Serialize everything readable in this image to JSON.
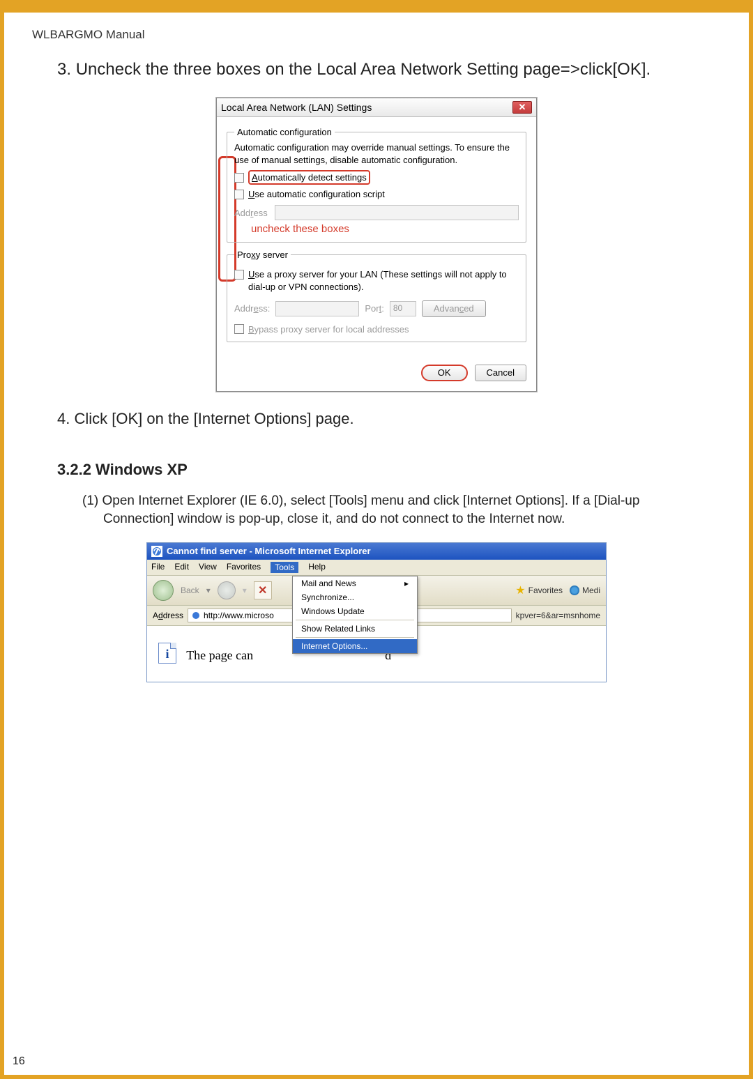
{
  "header": "WLBARGMO Manual",
  "step3_num": "3. ",
  "step3_text": "Uncheck the three boxes on the Local Area Network Setting page=>click[OK].",
  "lan": {
    "title": "Local Area Network (LAN) Settings",
    "group1_legend": "Automatic configuration",
    "group1_para": "Automatic configuration may override manual settings.  To ensure the use of manual settings, disable automatic configuration.",
    "auto_detect": "Automatically detect settings",
    "use_script": "Use automatic configuration script",
    "address_lbl": "Address",
    "uncheck_hint": "uncheck these boxes",
    "group2_legend": "Proxy server",
    "use_proxy": "Use a proxy server for your LAN (These settings will not apply to dial-up or VPN connections).",
    "port_lbl": "Port:",
    "port_val": "80",
    "advanced": "Advanced",
    "bypass": "Bypass proxy server for local addresses",
    "ok": "OK",
    "cancel": "Cancel"
  },
  "step4_num": "4. ",
  "step4_text": "Click [OK] on the [Internet Options] page.",
  "sec_heading": "3.2.2 Windows XP",
  "body1_num": "(1) ",
  "body1_text": "Open Internet Explorer (IE 6.0), select [Tools] menu and click [Internet Options]. If a [Dial-up Connection] window is pop-up, close it, and do not connect to the Internet now.",
  "ie": {
    "title": "Cannot find server - Microsoft Internet Explorer",
    "menu": {
      "file": "File",
      "edit": "Edit",
      "view": "View",
      "favorites_m": "Favorites",
      "tools": "Tools",
      "help": "Help"
    },
    "back": "Back",
    "favorites": "Favorites",
    "media": "Medi",
    "addr_label": "Address",
    "addr_val": "http://www.microso",
    "addr_frag": "kpver=6&ar=msnhome",
    "content_left": "The page can",
    "content_right": "d",
    "dd": {
      "mail": "Mail and News",
      "sync": "Synchronize...",
      "wu": "Windows Update",
      "related": "Show Related Links",
      "io": "Internet Options..."
    }
  },
  "page_num": "16"
}
